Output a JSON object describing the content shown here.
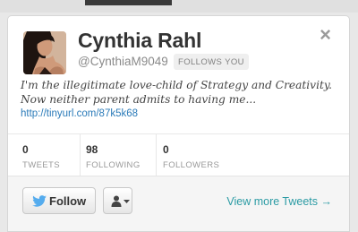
{
  "profile": {
    "name": "Cynthia Rahl",
    "screen_name": "@CynthiaM9049",
    "follows_you": "FOLLOWS YOU",
    "bio_lines": [
      "I'm the illegitimate love-child of Strategy and Creativity.",
      "Now neither parent admits to having me..."
    ],
    "url": "http://tinyurl.com/87k5k68"
  },
  "stats": [
    {
      "value": "0",
      "label": "TWEETS"
    },
    {
      "value": "98",
      "label": "FOLLOWING"
    },
    {
      "value": "0",
      "label": "FOLLOWERS"
    }
  ],
  "actions": {
    "follow_label": "Follow",
    "view_more": "View more Tweets →",
    "close_glyph": "×"
  },
  "colors": {
    "link": "#2b7bb9",
    "view_more": "#2b9ba4",
    "bird": "#55acee"
  },
  "icons": [
    "close-icon",
    "twitter-bird-icon",
    "person-icon",
    "caret-down-icon"
  ]
}
